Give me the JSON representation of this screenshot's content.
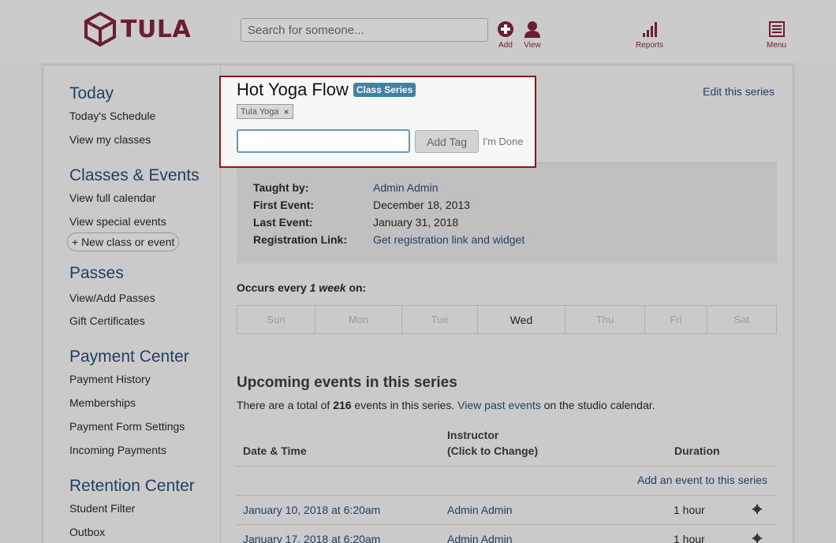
{
  "brand": {
    "name": "TULA",
    "color": "#6b1e2e"
  },
  "header": {
    "search_placeholder": "Search for someone...",
    "icons": [
      {
        "name": "add-icon",
        "label": "Add"
      },
      {
        "name": "view-icon",
        "label": "View"
      },
      {
        "name": "reports-icon",
        "label": "Reports"
      },
      {
        "name": "menu-icon",
        "label": "Menu"
      }
    ]
  },
  "sidebar": {
    "sections": [
      {
        "title": "Today",
        "items": [
          "Today's Schedule",
          "View my classes"
        ]
      },
      {
        "title": "Classes & Events",
        "items": [
          "View full calendar",
          "View special events"
        ],
        "button": "+ New class or event"
      },
      {
        "title": "Passes",
        "items": [
          "View/Add Passes",
          "Gift Certificates"
        ]
      },
      {
        "title": "Payment Center",
        "items": [
          "Payment History",
          "Memberships",
          "Payment Form Settings",
          "Incoming Payments"
        ]
      },
      {
        "title": "Retention Center",
        "items": [
          "Student Filter",
          "Outbox"
        ]
      }
    ]
  },
  "series": {
    "title": "Hot Yoga Flow",
    "badge": "Class Series",
    "tag": "Tula Yoga",
    "tag_remove": "×",
    "tag_input_value": "",
    "add_tag_label": "Add Tag",
    "done_label": "I'm Done",
    "edit_label": "Edit this series"
  },
  "info": {
    "taught_by_label": "Taught by:",
    "taught_by": "Admin Admin",
    "first_event_label": "First Event:",
    "first_event": "December 18, 2013",
    "last_event_label": "Last Event:",
    "last_event": "January 31, 2018",
    "registration_label": "Registration Link:",
    "registration_link": "Get registration link and widget"
  },
  "schedule": {
    "occurs_prefix": "Occurs every ",
    "occurs_interval": "1 week",
    "occurs_suffix": " on:",
    "days": [
      {
        "label": "Sun",
        "active": false
      },
      {
        "label": "Mon",
        "active": false
      },
      {
        "label": "Tue",
        "active": false
      },
      {
        "label": "Wed",
        "active": true
      },
      {
        "label": "Thu",
        "active": false
      },
      {
        "label": "Fri",
        "active": false
      },
      {
        "label": "Sat",
        "active": false
      }
    ]
  },
  "upcoming": {
    "heading": "Upcoming events in this series",
    "total_prefix": "There are a total of ",
    "total_count": "216",
    "total_mid": " events in this series. ",
    "past_link": "View past events",
    "total_suffix": " on the studio calendar.",
    "col_date": "Date & Time",
    "col_instructor_1": "Instructor",
    "col_instructor_2": "(Click to Change)",
    "col_duration": "Duration",
    "add_event_label": "Add an event to this series",
    "rows": [
      {
        "date": "January 10, 2018 at 6:20am",
        "instructor": "Admin Admin",
        "duration": "1 hour"
      },
      {
        "date": "January 17, 2018 at 6:20am",
        "instructor": "Admin Admin",
        "duration": "1 hour"
      }
    ]
  }
}
